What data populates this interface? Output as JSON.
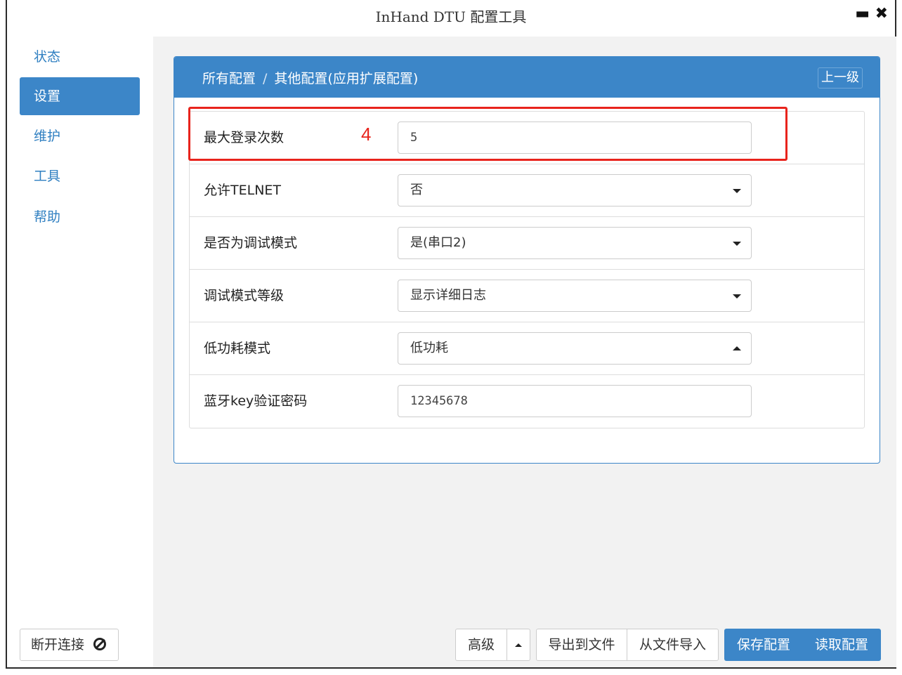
{
  "window": {
    "title": "InHand DTU 配置工具",
    "minimize_icon": "minimize-icon",
    "close_icon": "close-icon"
  },
  "sidebar": {
    "items": [
      {
        "label": "状态",
        "active": false
      },
      {
        "label": "设置",
        "active": true
      },
      {
        "label": "维护",
        "active": false
      },
      {
        "label": "工具",
        "active": false
      },
      {
        "label": "帮助",
        "active": false
      }
    ],
    "disconnect_label": "断开连接",
    "disconnect_icon": "ban-icon"
  },
  "panel": {
    "breadcrumb": [
      "所有配置",
      "其他配置(应用扩展配置)"
    ],
    "breadcrumb_separator": "/",
    "up_label": "上一级"
  },
  "form": {
    "rows": [
      {
        "label": "最大登录次数",
        "type": "input",
        "value": "5"
      },
      {
        "label": "允许TELNET",
        "type": "select",
        "value": "否"
      },
      {
        "label": "是否为调试模式",
        "type": "select",
        "value": "是(串口2)"
      },
      {
        "label": "调试模式等级",
        "type": "select",
        "value": "显示详细日志"
      },
      {
        "label": "低功耗模式",
        "type": "select",
        "value": "低功耗",
        "expanded": true
      },
      {
        "label": "蓝牙key验证密码",
        "type": "input",
        "value": "12345678"
      }
    ]
  },
  "annotation": {
    "number": "4",
    "color": "#e8241c"
  },
  "footer": {
    "advanced_label": "高级",
    "export_label": "导出到文件",
    "import_label": "从文件导入",
    "save_label": "保存配置",
    "read_label": "读取配置"
  },
  "colors": {
    "accent": "#3c86c8",
    "nav_text": "#2f7fc1",
    "annotation": "#e8241c"
  }
}
